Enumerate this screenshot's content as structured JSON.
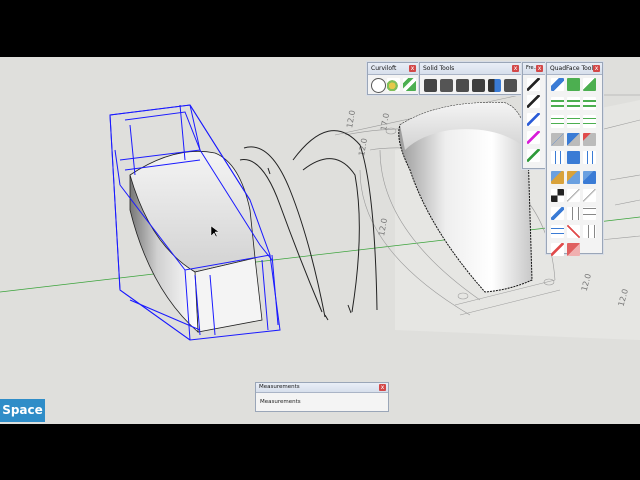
{
  "badge": {
    "label": "Space"
  },
  "toolbars": {
    "curviloft": {
      "title": "Curviloft",
      "close": "x"
    },
    "solid_tools": {
      "title": "Solid Tools",
      "close": "x"
    },
    "fredo": {
      "title": "Fre...",
      "close": "x"
    },
    "quadface": {
      "title": "QuadFace Tools",
      "close": "x"
    }
  },
  "measurements": {
    "title": "Measurements",
    "close": "x",
    "label": "Measurements"
  },
  "dims": {
    "d1": "12.0",
    "d2": "12.0",
    "d3": "12.0",
    "d4": "17.0",
    "d5": "12.0",
    "d6": "12.0"
  },
  "colors": {
    "selection_blue": "#1a1aff",
    "green_axis": "#2a9a2a",
    "badge_blue": "#2f8dc8"
  }
}
